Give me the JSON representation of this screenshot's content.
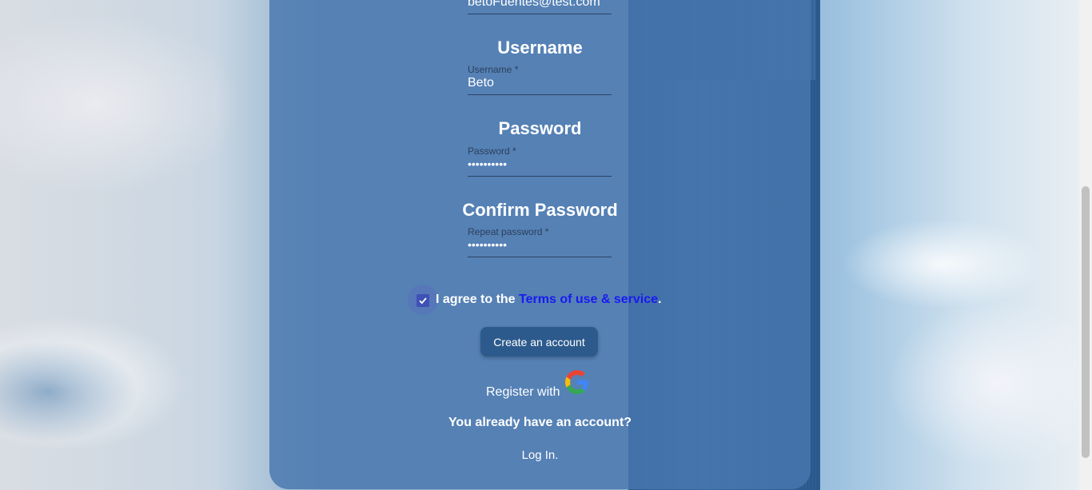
{
  "form": {
    "email_value": "betoFuentes@test.com",
    "username": {
      "title": "Username",
      "label": "Username *",
      "value": "Beto"
    },
    "password": {
      "title": "Password",
      "label": "Password *",
      "value": "••••••••••"
    },
    "confirm_password": {
      "title": "Confirm Password",
      "label": "Repeat password *",
      "value": "••••••••••"
    },
    "terms": {
      "checked": true,
      "prefix": "I agree to the ",
      "link_text": "Terms of use & service",
      "suffix": "."
    },
    "create_button_label": "Create an account",
    "register_with_label": "Register with",
    "google_icon": "google-icon",
    "already_have_account": "You already have an account?",
    "login_link": "Log In."
  },
  "colors": {
    "panel": "#4876af",
    "checkbox": "#3f51b5",
    "link": "#1a1af0",
    "button": "#2d5a8c"
  }
}
